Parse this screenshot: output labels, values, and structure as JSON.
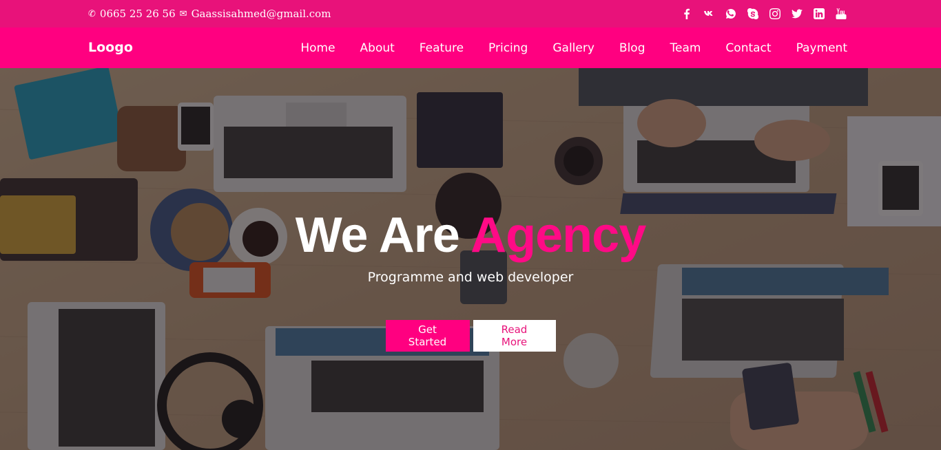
{
  "topbar": {
    "phone": "0665 25 26 56",
    "email": "Gaassisahmed@gmail.com",
    "phone_icon": "phone-icon",
    "email_icon": "envelope-icon",
    "social": [
      "facebook-icon",
      "vk-icon",
      "whatsapp-icon",
      "skype-icon",
      "instagram-icon",
      "twitter-icon",
      "linkedin-icon",
      "youtube-icon"
    ]
  },
  "navbar": {
    "logo": "Loogo",
    "items": [
      "Home",
      "About",
      "Feature",
      "Pricing",
      "Gallery",
      "Blog",
      "Team",
      "Contact",
      "Payment"
    ]
  },
  "hero": {
    "title_main": "We Are ",
    "title_accent": "Agency",
    "subtitle": "Programme and web developer",
    "primary_button": "Get Started",
    "secondary_button": "Read More"
  },
  "colors": {
    "topbar": "#e8127a",
    "navbar": "#ff0080",
    "accent": "#ff0a86"
  }
}
